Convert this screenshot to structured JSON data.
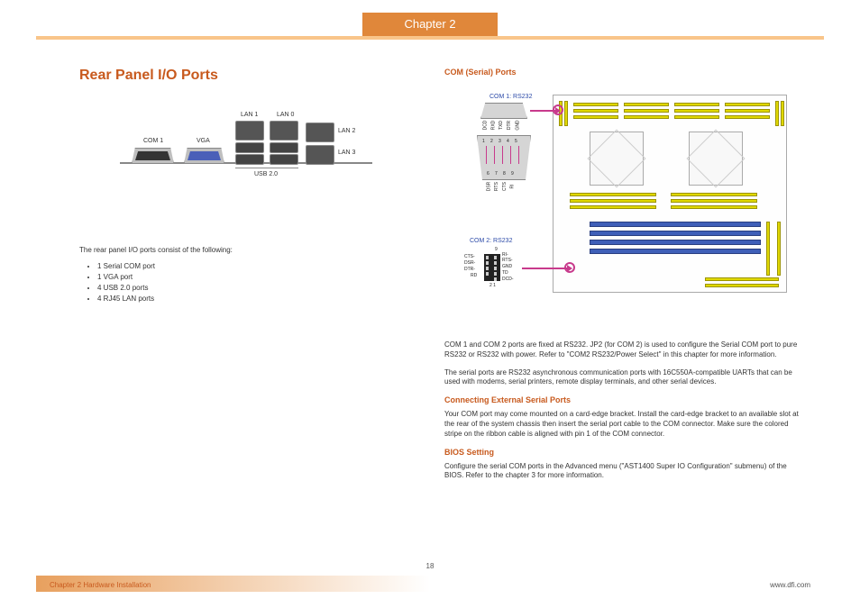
{
  "chapter_tab": "Chapter 2",
  "title_main": "Rear Panel I/O Ports",
  "labels": {
    "com1": "COM 1",
    "vga": "VGA",
    "lan1": "LAN 1",
    "lan0": "LAN 0",
    "lan2": "LAN 2",
    "lan3": "LAN 3",
    "usb20": "USB 2.0"
  },
  "intro": "The rear panel I/O ports consist of the following:",
  "bullets": [
    "1 Serial COM port",
    "1 VGA port",
    "4 USB 2.0 ports",
    "4 RJ45 LAN ports"
  ],
  "sub_h": "COM (Serial) Ports",
  "com1_lbl": "COM 1: RS232",
  "com2_lbl": "COM 2: RS232",
  "pins_top": {
    "p1": "1",
    "p2": "2",
    "p3": "3",
    "p4": "4",
    "p5": "5"
  },
  "pins_bot": {
    "p6": "6",
    "p7": "7",
    "p8": "8",
    "p9": "9"
  },
  "pin_names_top": {
    "a": "DCD",
    "b": "RXD",
    "c": "TXD",
    "d": "DTR",
    "e": "GND"
  },
  "pin_names_bot": {
    "a": "DSR",
    "b": "RTS",
    "c": "CTS",
    "d": "RI"
  },
  "com2_pins": {
    "l1": "CTS-",
    "l2": "DSR-",
    "l3": "DTR-",
    "l4": "RD",
    "r1": "RI-",
    "r2": "RTS-",
    "r3": "GND",
    "r4": "TD",
    "r5": "DCD-",
    "top": "9",
    "bot": "2 1"
  },
  "para1": "COM 1 and COM 2 ports are fixed at RS232. JP2 (for COM 2) is used to configure the Serial COM port to pure RS232 or RS232 with power. Refer to \"COM2 RS232/Power Select\" in this chapter for more information.",
  "para2": "The serial ports are RS232 asynchronous communication ports with 16C550A-compatible UARTs that can be used with modems, serial printers, remote display terminals, and other serial devices.",
  "sub_h2": "Connecting External Serial Ports",
  "para3": "Your COM port may come mounted on a card-edge bracket. Install the card-edge bracket to an available slot at the rear of the system chassis then insert the serial port cable to the COM connector. Make sure the colored stripe on the ribbon cable is aligned with pin 1 of the COM connector.",
  "sub_h3": "BIOS Setting",
  "para4": "Configure the serial COM ports in the Advanced menu (\"AST1400 Super IO Configuration\" submenu) of the BIOS. Refer to the chapter 3 for more information.",
  "page_num": "18",
  "footer_left": "Chapter 2 Hardware Installation",
  "footer_right": "www.dfi.com"
}
